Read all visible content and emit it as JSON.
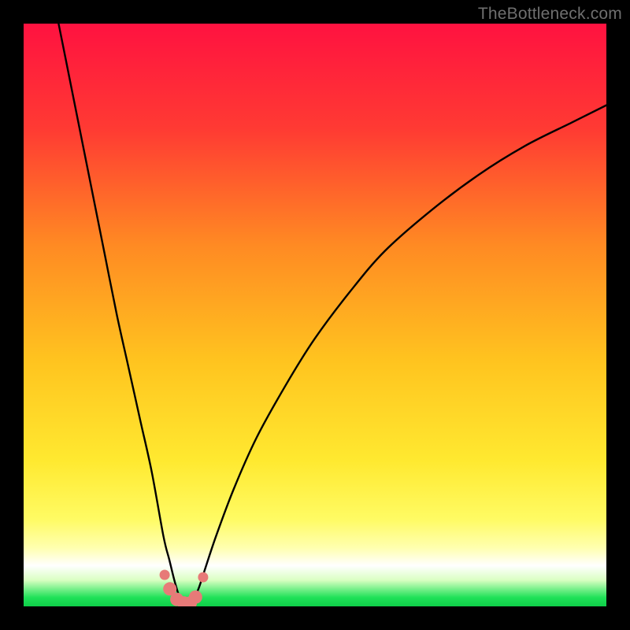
{
  "watermark": "TheBottleneck.com",
  "colors": {
    "top": "#ff1240",
    "mid_red_orange": "#ff5a2a",
    "mid_orange": "#ffa321",
    "mid_yellow": "#ffe22a",
    "pale_yellow": "#ffff9e",
    "white_band": "#ffffff",
    "green": "#18e35a",
    "curve": "#000000",
    "marker_fill": "#e77a78",
    "marker_stroke": "#cf5d5b"
  },
  "chart_data": {
    "type": "line",
    "title": "",
    "xlabel": "",
    "ylabel": "",
    "xlim": [
      0,
      100
    ],
    "ylim": [
      0,
      100
    ],
    "note": "Axis values are relative (no numeric ticks are shown in the image). y represents bottleneck % where 0 is ideal (green band at bottom) and 100 is worst (red top). Curve dips to minimum near x≈27.",
    "series": [
      {
        "name": "bottleneck-curve",
        "x": [
          6,
          8,
          10,
          12,
          14,
          16,
          18,
          20,
          22,
          24,
          25,
          26,
          27,
          28,
          29,
          30,
          31,
          33,
          36,
          40,
          45,
          50,
          56,
          62,
          70,
          78,
          86,
          94,
          100
        ],
        "y": [
          100,
          90,
          80,
          70,
          60,
          50,
          41,
          32,
          23,
          12,
          8,
          4,
          1,
          0.5,
          1,
          3,
          6,
          12,
          20,
          29,
          38,
          46,
          54,
          61,
          68,
          74,
          79,
          83,
          86
        ]
      }
    ],
    "markers": {
      "name": "highlighted-points",
      "x": [
        24.2,
        25.1,
        26.3,
        27.5,
        28.6,
        29.5,
        30.8
      ],
      "y": [
        5.4,
        3.0,
        1.2,
        0.6,
        0.6,
        1.6,
        5.0
      ]
    },
    "bands": [
      {
        "name": "red-zone",
        "y_from": 40,
        "y_to": 100
      },
      {
        "name": "orange-zone",
        "y_from": 15,
        "y_to": 40
      },
      {
        "name": "yellow-zone",
        "y_from": 5,
        "y_to": 15
      },
      {
        "name": "green-zone",
        "y_from": 0,
        "y_to": 5
      }
    ]
  }
}
